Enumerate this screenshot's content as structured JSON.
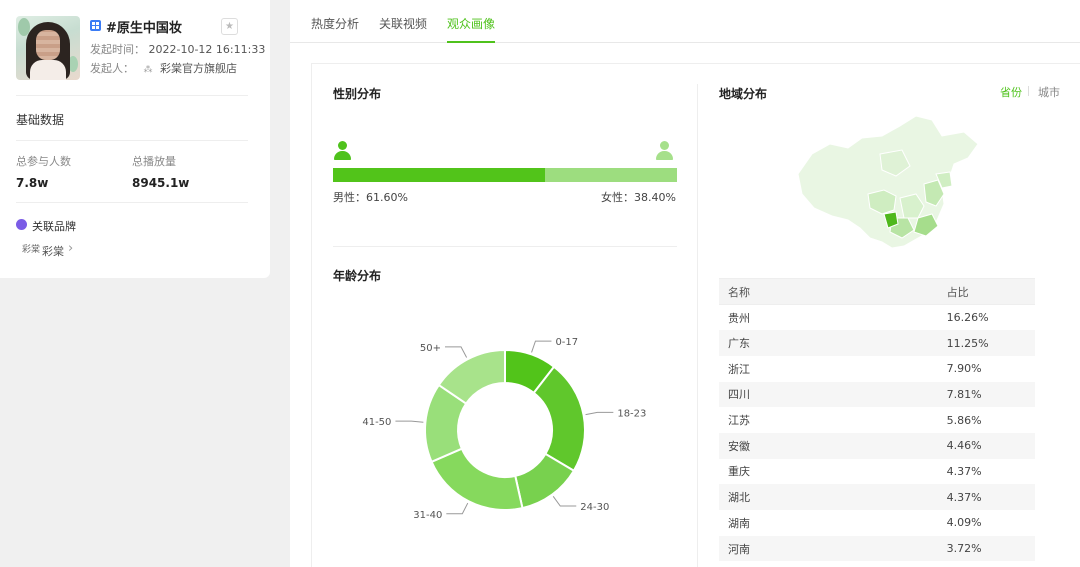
{
  "topic": {
    "title": "#原生中国妆",
    "meta_time_label": "发起时间：",
    "meta_time_value": "2022-10-12 16:11:33",
    "meta_user_label": "发起人：",
    "meta_user_value": "彩棠官方旗舰店"
  },
  "basic": {
    "title": "基础数据",
    "stats": [
      {
        "label": "总参与人数",
        "value": "7.8w"
      },
      {
        "label": "总播放量",
        "value": "8945.1w"
      }
    ]
  },
  "brand": {
    "title": "关联品牌",
    "name": "彩棠",
    "logo_text": "彩棠"
  },
  "tabs": [
    "热度分析",
    "关联视频",
    "观众画像"
  ],
  "active_tab": "观众画像",
  "gender": {
    "title": "性别分布",
    "male_label": "男性：61.60%",
    "female_label": "女性：38.40%",
    "male_ratio": 0.616,
    "female_ratio": 0.384
  },
  "age": {
    "title": "年龄分布"
  },
  "region": {
    "title": "地域分布",
    "tabs": [
      "省份",
      "城市"
    ],
    "active_tab": "省份",
    "columns": [
      "名称",
      "占比"
    ],
    "rows": [
      [
        "贵州",
        "16.26%"
      ],
      [
        "广东",
        "11.25%"
      ],
      [
        "浙江",
        "7.90%"
      ],
      [
        "四川",
        "7.81%"
      ],
      [
        "江苏",
        "5.86%"
      ],
      [
        "安徽",
        "4.46%"
      ],
      [
        "重庆",
        "4.37%"
      ],
      [
        "湖北",
        "4.37%"
      ],
      [
        "湖南",
        "4.09%"
      ],
      [
        "河南",
        "3.72%"
      ]
    ]
  },
  "chart_data": {
    "type": "pie",
    "categories": [
      "0-17",
      "18-23",
      "24-30",
      "31-40",
      "41-50",
      "50+"
    ],
    "values": [
      10.5,
      23,
      13,
      22,
      16,
      15.5
    ],
    "colors": [
      "#52c41a",
      "#60c72c",
      "#78d14e",
      "#86d95d",
      "#99df7a",
      "#a8e38b"
    ],
    "title": "年龄分布"
  },
  "colors": {
    "accent": "#4fc21c",
    "male": "#52c41a",
    "female": "#9ddd7f"
  }
}
